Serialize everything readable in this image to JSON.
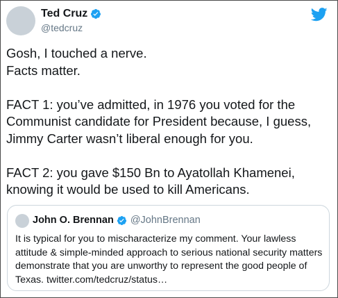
{
  "author": {
    "name": "Ted Cruz",
    "handle": "@tedcruz"
  },
  "tweet": {
    "text": "Gosh, I touched a nerve.\nFacts matter.\n\nFACT 1: you’ve admitted, in 1976 you voted for the Communist candidate for President because, I guess, Jimmy Carter wasn’t liberal enough for you.\n\nFACT 2: you gave $150 Bn to Ayatollah Khamenei, knowing it would be used to kill Americans."
  },
  "quoted": {
    "name": "John O. Brennan",
    "handle": "@JohnBrennan",
    "text": "It is typical for you to mischaracterize my comment. Your lawless attitude & simple-minded approach to serious national security matters demonstrate that you are unworthy to represent the good people of Texas. twitter.com/tedcruz/status…"
  },
  "colors": {
    "verified_blue": "#1da1f2",
    "twitter_blue": "#1da1f2",
    "secondary_text": "#657786"
  },
  "icons": {
    "verified": "verified-badge-icon",
    "logo": "twitter-bird-icon"
  }
}
